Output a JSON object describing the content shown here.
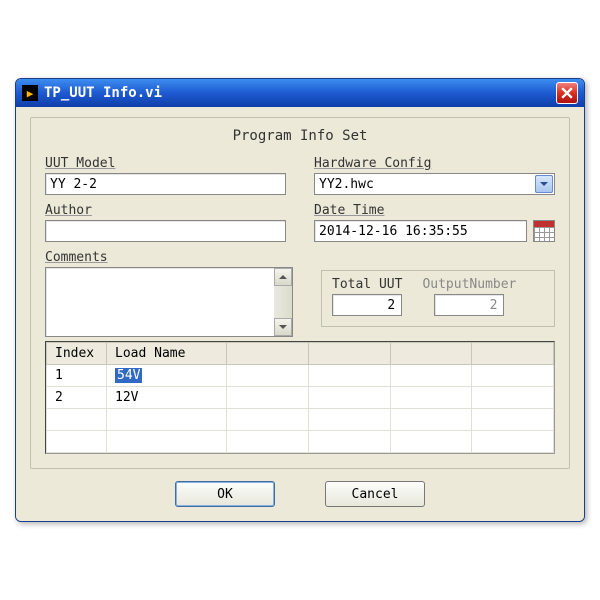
{
  "window": {
    "title": "TP_UUT Info.vi"
  },
  "group": {
    "title": "Program Info Set"
  },
  "fields": {
    "uut_model": {
      "label": "UUT Model",
      "value": "YY 2-2"
    },
    "hardware_config": {
      "label": "Hardware Config",
      "value": "YY2.hwc"
    },
    "author": {
      "label": "Author",
      "value": ""
    },
    "date_time": {
      "label": "Date Time",
      "value": "2014-12-16 16:35:55"
    },
    "comments": {
      "label": "Comments",
      "value": ""
    },
    "total_uut": {
      "label": "Total UUT",
      "value": "2"
    },
    "output_number": {
      "label": "OutputNumber",
      "value": "2"
    }
  },
  "table": {
    "headers": {
      "index": "Index",
      "load_name": "Load Name"
    },
    "rows": [
      {
        "index": "1",
        "load_name": "54V",
        "selected": true
      },
      {
        "index": "2",
        "load_name": "12V",
        "selected": false
      }
    ]
  },
  "buttons": {
    "ok": "OK",
    "cancel": "Cancel"
  }
}
